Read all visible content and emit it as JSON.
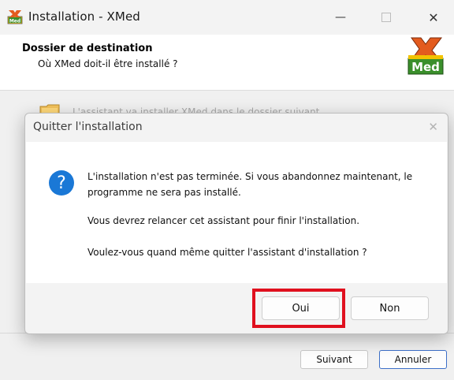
{
  "window": {
    "title": "Installation - XMed",
    "minimize_icon": "minimize-icon",
    "maximize_icon": "maximize-icon",
    "close_icon": "close-icon"
  },
  "header": {
    "title": "Dossier de destination",
    "subtitle": "Où XMed doit-il être installé ?",
    "logo_text": "Med"
  },
  "body": {
    "background_text": "L'assistant va installer XMed dans le dossier suivant."
  },
  "footer": {
    "next_label": "Suivant",
    "cancel_label": "Annuler"
  },
  "dialog": {
    "title": "Quitter l'installation",
    "icon": "question-icon",
    "message_line1": "L'installation n'est pas terminée. Si vous abandonnez maintenant, le programme ne sera pas installé.",
    "message_line2": "Vous devrez relancer cet assistant pour finir l'installation.",
    "message_line3": "Voulez-vous quand même quitter l'assistant d'installation ?",
    "yes_label": "Oui",
    "no_label": "Non"
  },
  "colors": {
    "highlight": "#e0101e",
    "question_icon": "#1a78d6",
    "logo_green": "#3a8f2b",
    "logo_orange": "#e35b1e"
  }
}
